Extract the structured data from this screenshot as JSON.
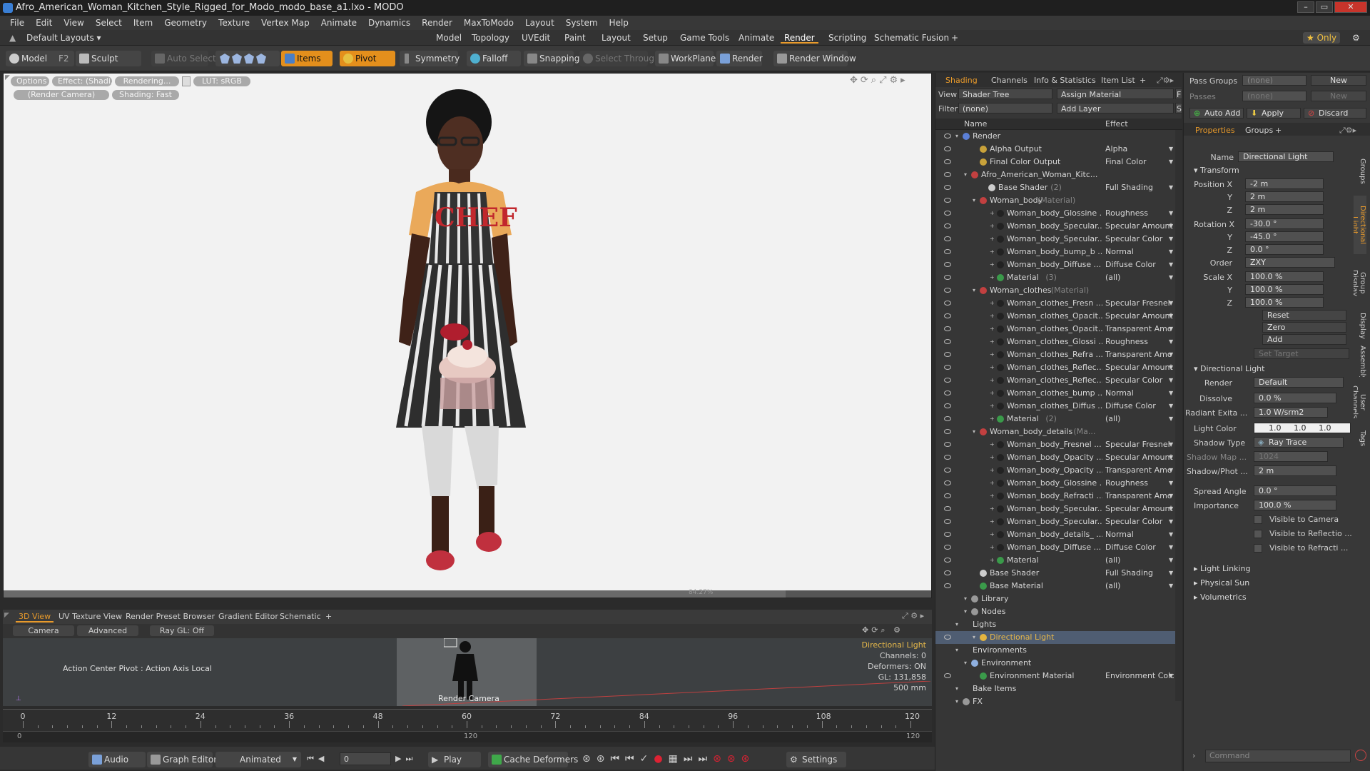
{
  "window": {
    "title": "Afro_American_Woman_Kitchen_Style_Rigged_for_Modo_modo_base_a1.lxo - MODO",
    "min": "–",
    "max": "▭",
    "close": "✕"
  },
  "menu": [
    "File",
    "Edit",
    "View",
    "Select",
    "Item",
    "Geometry",
    "Texture",
    "Vertex Map",
    "Animate",
    "Dynamics",
    "Render",
    "MaxToModo",
    "Layout",
    "System",
    "Help"
  ],
  "layout": {
    "preset": "Default Layouts ▾",
    "tabs": [
      "Model",
      "Topology",
      "UVEdit",
      "Paint",
      "Layout",
      "Setup",
      "Game Tools",
      "Animate",
      "Render",
      "Scripting",
      "Schematic Fusion",
      "+"
    ],
    "active_tab": "Render",
    "only": "★ Only",
    "gear": "⚙"
  },
  "toolbar": {
    "model": "Model",
    "f2": "F2",
    "sculpt": "Sculpt",
    "auto_select": "Auto Select",
    "items": "Items",
    "pivot": "Pivot",
    "symmetry": "Symmetry",
    "falloff": "Falloff",
    "snapping": "Snapping",
    "select_through": "Select Through",
    "workplane": "WorkPlane",
    "render": "Render",
    "render_window": "Render Window"
  },
  "viewport": {
    "pills": [
      "Options",
      "Effect: (Shadi...",
      "Rendering...",
      "LUT: sRGB",
      "(Render Camera)",
      "Shading: Fast"
    ],
    "progress": "84.27%",
    "apron_text": "CHEF"
  },
  "bottom_panel": {
    "tabs": [
      "3D View",
      "UV Texture View",
      "Render Preset Browser",
      "Gradient Editor",
      "Schematic",
      "+"
    ],
    "buttons": [
      "Camera",
      "Advanced",
      "Ray GL: Off"
    ],
    "action_center": "Action Center Pivot : Action Axis Local",
    "render_camera": "Render Camera",
    "info": [
      "Directional Light",
      "Channels: 0",
      "Deformers: ON",
      "GL: 131,858",
      "500 mm"
    ]
  },
  "timeline": {
    "ticks": [
      "0",
      "12",
      "24",
      "36",
      "48",
      "60",
      "72",
      "84",
      "96",
      "108",
      "120"
    ],
    "lower_left": "0",
    "lower_mid": "120",
    "lower_right": "120"
  },
  "transport": {
    "audio": "Audio",
    "graph_editor": "Graph Editor",
    "animated": "Animated",
    "frame": "0",
    "play": "Play",
    "cache_deformers": "Cache Deformers",
    "settings": "Settings"
  },
  "shading": {
    "tabs": [
      "Shading",
      "Channels",
      "Info & Statistics",
      "Item List",
      "+"
    ],
    "view_label": "View",
    "view_value": "Shader Tree",
    "assign_material": "Assign Material",
    "f_btn": "F",
    "filter_label": "Filter",
    "filter_value": "(none)",
    "add_layer": "Add Layer",
    "s_btn": "S",
    "col_name": "Name",
    "col_effect": "Effect",
    "rows": [
      {
        "name": "Render",
        "effect": "",
        "indent": 0,
        "ic": "#5b7fd6",
        "eye": true
      },
      {
        "name": "Alpha Output",
        "effect": "Alpha",
        "indent": 2,
        "ic": "#c9a23a",
        "eye": true
      },
      {
        "name": "Final Color Output",
        "effect": "Final Color",
        "indent": 2,
        "ic": "#c9a23a",
        "eye": true
      },
      {
        "name": "Afro_American_Woman_Kitc...",
        "effect": "",
        "indent": 1,
        "ic": "#c24040",
        "eye": true
      },
      {
        "name": "Base Shader",
        "suffix": "(2)",
        "effect": "Full Shading",
        "indent": 3,
        "ic": "#cccccc",
        "eye": true
      },
      {
        "name": "Woman_body",
        "suffix": "(Material)",
        "effect": "",
        "indent": 2,
        "ic": "#c24040",
        "eye": true
      },
      {
        "name": "Woman_body_Glossine ...",
        "effect": "Roughness",
        "indent": 4,
        "ic": "#222222",
        "eye": true
      },
      {
        "name": "Woman_body_Specular...",
        "effect": "Specular Amount",
        "indent": 4,
        "ic": "#222222",
        "eye": true
      },
      {
        "name": "Woman_body_Specular...",
        "effect": "Specular Color",
        "indent": 4,
        "ic": "#222222",
        "eye": true
      },
      {
        "name": "Woman_body_bump_b ...",
        "effect": "Normal",
        "indent": 4,
        "ic": "#222222",
        "eye": true
      },
      {
        "name": "Woman_body_Diffuse ...",
        "effect": "Diffuse Color",
        "indent": 4,
        "ic": "#222222",
        "eye": true
      },
      {
        "name": "Material",
        "suffix": "(3)",
        "effect": "(all)",
        "indent": 4,
        "ic": "#3a9a4a",
        "eye": true
      },
      {
        "name": "Woman_clothes",
        "suffix": "(Material)",
        "effect": "",
        "indent": 2,
        "ic": "#c24040",
        "eye": true
      },
      {
        "name": "Woman_clothes_Fresn ...",
        "effect": "Specular Fresnel",
        "indent": 4,
        "ic": "#222222",
        "eye": true
      },
      {
        "name": "Woman_clothes_Opacit...",
        "effect": "Specular Amount",
        "indent": 4,
        "ic": "#222222",
        "eye": true
      },
      {
        "name": "Woman_clothes_Opacit...",
        "effect": "Transparent Amo ...",
        "indent": 4,
        "ic": "#222222",
        "eye": true
      },
      {
        "name": "Woman_clothes_Glossi ...",
        "effect": "Roughness",
        "indent": 4,
        "ic": "#222222",
        "eye": true
      },
      {
        "name": "Woman_clothes_Refra ...",
        "effect": "Transparent Amo ...",
        "indent": 4,
        "ic": "#222222",
        "eye": true
      },
      {
        "name": "Woman_clothes_Reflec...",
        "effect": "Specular Amount",
        "indent": 4,
        "ic": "#222222",
        "eye": true
      },
      {
        "name": "Woman_clothes_Reflec...",
        "effect": "Specular Color",
        "indent": 4,
        "ic": "#222222",
        "eye": true
      },
      {
        "name": "Woman_clothes_bump ...",
        "effect": "Normal",
        "indent": 4,
        "ic": "#222222",
        "eye": true
      },
      {
        "name": "Woman_clothes_Diffus ...",
        "effect": "Diffuse Color",
        "indent": 4,
        "ic": "#222222",
        "eye": true
      },
      {
        "name": "Material",
        "suffix": "(2)",
        "effect": "(all)",
        "indent": 4,
        "ic": "#3a9a4a",
        "eye": true
      },
      {
        "name": "Woman_body_details",
        "suffix": "(Ma...",
        "effect": "",
        "indent": 2,
        "ic": "#c24040",
        "eye": true
      },
      {
        "name": "Woman_body_Fresnel ...",
        "effect": "Specular Fresnel",
        "indent": 4,
        "ic": "#222222",
        "eye": true
      },
      {
        "name": "Woman_body_Opacity ...",
        "effect": "Specular Amount",
        "indent": 4,
        "ic": "#222222",
        "eye": true
      },
      {
        "name": "Woman_body_Opacity ...",
        "effect": "Transparent Amo ...",
        "indent": 4,
        "ic": "#222222",
        "eye": true
      },
      {
        "name": "Woman_body_Glossine ...",
        "effect": "Roughness",
        "indent": 4,
        "ic": "#222222",
        "eye": true
      },
      {
        "name": "Woman_body_Refracti ...",
        "effect": "Transparent Amo ...",
        "indent": 4,
        "ic": "#222222",
        "eye": true
      },
      {
        "name": "Woman_body_Specular...",
        "effect": "Specular Amount",
        "indent": 4,
        "ic": "#222222",
        "eye": true
      },
      {
        "name": "Woman_body_Specular...",
        "effect": "Specular Color",
        "indent": 4,
        "ic": "#222222",
        "eye": true
      },
      {
        "name": "Woman_body_details_ ...",
        "effect": "Normal",
        "indent": 4,
        "ic": "#222222",
        "eye": true
      },
      {
        "name": "Woman_body_Diffuse ...",
        "effect": "Diffuse Color",
        "indent": 4,
        "ic": "#222222",
        "eye": true
      },
      {
        "name": "Material",
        "effect": "(all)",
        "indent": 4,
        "ic": "#3a9a4a",
        "eye": true
      },
      {
        "name": "Base Shader",
        "effect": "Full Shading",
        "indent": 2,
        "ic": "#cccccc",
        "eye": true
      },
      {
        "name": "Base Material",
        "effect": "(all)",
        "indent": 2,
        "ic": "#3a9a4a",
        "eye": true
      },
      {
        "name": "Library",
        "effect": "",
        "indent": 1,
        "ic": "#999999",
        "eye": false
      },
      {
        "name": "Nodes",
        "effect": "",
        "indent": 1,
        "ic": "#999999",
        "eye": false
      },
      {
        "name": "Lights",
        "effect": "",
        "indent": 0,
        "ic": "",
        "eye": false
      },
      {
        "name": "Directional Light",
        "effect": "",
        "indent": 2,
        "ic": "#e3b440",
        "eye": true,
        "sel": true
      },
      {
        "name": "Environments",
        "effect": "",
        "indent": 0,
        "ic": "",
        "eye": false
      },
      {
        "name": "Environment",
        "effect": "",
        "indent": 1,
        "ic": "#8fb0e0",
        "eye": false
      },
      {
        "name": "Environment Material",
        "effect": "Environment Color",
        "indent": 2,
        "ic": "#3a9a4a",
        "eye": true
      },
      {
        "name": "Bake Items",
        "effect": "",
        "indent": 0,
        "ic": "",
        "eye": false
      },
      {
        "name": "FX",
        "effect": "",
        "indent": 0,
        "ic": "#999999",
        "eye": false
      }
    ]
  },
  "props": {
    "pass_groups_label": "Pass Groups",
    "pass_groups_value": "(none)",
    "new1": "New",
    "passes_label": "Passes",
    "passes_value": "(none)",
    "new2": "New",
    "auto_add": "Auto Add",
    "apply": "Apply",
    "discard": "Discard",
    "tabs": [
      "Properties",
      "Groups",
      "+"
    ],
    "name_label": "Name",
    "name_value": "Directional Light",
    "transform": "Transform",
    "pos_x_label": "Position X",
    "pos_x": "-2 m",
    "pos_y": "2 m",
    "pos_z": "2 m",
    "rot_x_label": "Rotation X",
    "rot_x": "-30.0 °",
    "rot_y": "-45.0 °",
    "rot_z": "0.0 °",
    "order_label": "Order",
    "order": "ZXY",
    "scale_x_label": "Scale X",
    "scale_x": "100.0 %",
    "scale_y": "100.0 %",
    "scale_z": "100.0 %",
    "y": "Y",
    "z": "Z",
    "reset": "Reset",
    "zero": "Zero",
    "add": "Add",
    "set_target": "Set Target",
    "dl_section": "Directional Light",
    "render_label": "Render",
    "render_value": "Default",
    "dissolve_label": "Dissolve",
    "dissolve_value": "0.0 %",
    "radiant_label": "Radiant Exita ...",
    "radiant_value": "1.0 W/srm2",
    "light_color_label": "Light Color",
    "lc_r": "1.0",
    "lc_g": "1.0",
    "lc_b": "1.0",
    "shadow_type_label": "Shadow Type",
    "shadow_type_value": "Ray Trace",
    "shadow_map_label": "Shadow Map ...",
    "shadow_map_value": "1024",
    "shadow_phot_label": "Shadow/Phot ...",
    "shadow_phot_value": "2 m",
    "spread_label": "Spread Angle",
    "spread_value": "0.0 °",
    "importance_label": "Importance",
    "importance_value": "100.0 %",
    "vis_camera": "Visible to Camera",
    "vis_reflect": "Visible to Reflectio ...",
    "vis_refract": "Visible to Refracti ...",
    "light_linking": "Light Linking",
    "physical_sun": "Physical Sun",
    "volumetrics": "Volumetrics",
    "vtabs": [
      "Groups",
      "Directional Light",
      "Group Display",
      "Display",
      "Assembly",
      "User Channels",
      "Tags"
    ],
    "command_placeholder": "Command"
  },
  "colors": {
    "accent": "#e89a2b",
    "viewport_bg": "#f2f2f2",
    "selection": "#4f5d72"
  }
}
